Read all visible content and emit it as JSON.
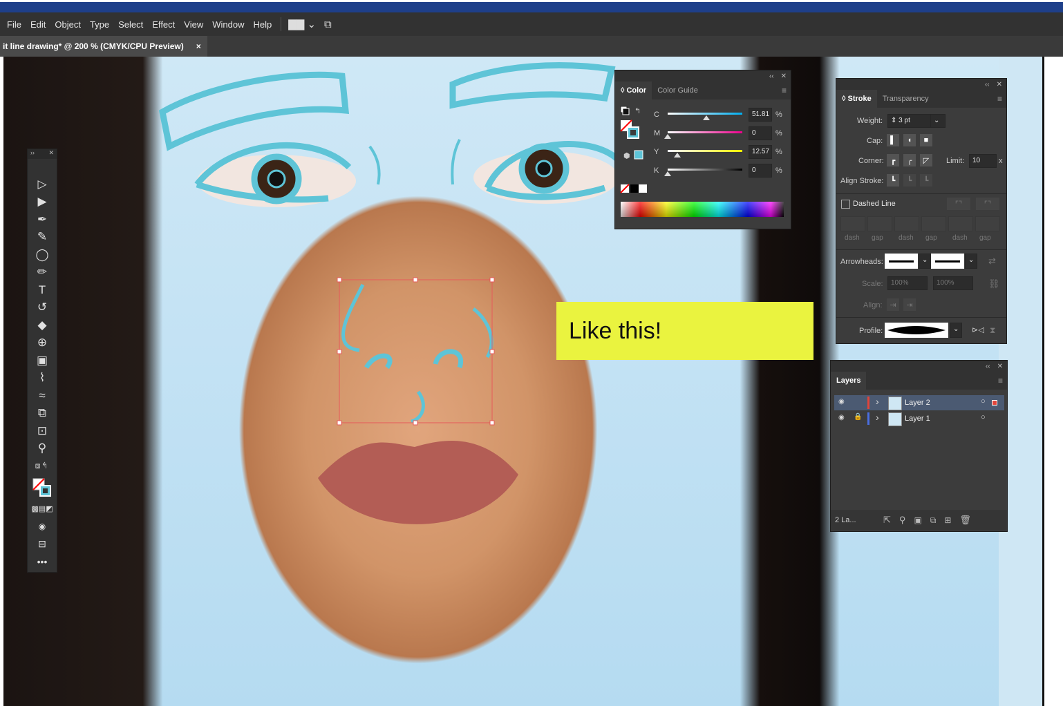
{
  "menu": {
    "items": [
      "File",
      "Edit",
      "Object",
      "Type",
      "Select",
      "Effect",
      "View",
      "Window",
      "Help"
    ],
    "workspace_icon": "workspace-switcher-icon",
    "arrange_icon": "arrange-documents-icon"
  },
  "doc_tab": {
    "title": "it line drawing* @ 200 % (CMYK/CPU Preview)",
    "close": "×"
  },
  "note": {
    "text": "Like this!"
  },
  "color_panel": {
    "tabs": [
      "◊ Color",
      "Color Guide"
    ],
    "channels": [
      {
        "label": "C",
        "value": "51.81",
        "pct": 51.81,
        "unit": "%"
      },
      {
        "label": "M",
        "value": "0",
        "pct": 0,
        "unit": "%"
      },
      {
        "label": "Y",
        "value": "12.57",
        "pct": 12.57,
        "unit": "%"
      },
      {
        "label": "K",
        "value": "0",
        "pct": 0,
        "unit": "%"
      }
    ],
    "stroke_color": "#5ec4d7"
  },
  "stroke_panel": {
    "tabs": [
      "◊ Stroke",
      "Transparency"
    ],
    "weight_label": "Weight:",
    "weight_value": "3 pt",
    "cap_label": "Cap:",
    "corner_label": "Corner:",
    "limit_label": "Limit:",
    "limit_value": "10",
    "limit_x": "x",
    "align_label": "Align Stroke:",
    "dashed_label": "Dashed Line",
    "dash_labels": [
      "dash",
      "gap",
      "dash",
      "gap",
      "dash",
      "gap"
    ],
    "arrowheads_label": "Arrowheads:",
    "scale_label": "Scale:",
    "scale_values": [
      "100%",
      "100%"
    ],
    "align_label2": "Align:",
    "profile_label": "Profile:"
  },
  "layers_panel": {
    "tab": "Layers",
    "layers": [
      {
        "name": "Layer 2",
        "color": "#e0443a",
        "locked": false,
        "selected": true
      },
      {
        "name": "Layer 1",
        "color": "#4a6ee0",
        "locked": true,
        "selected": false
      }
    ],
    "footer_count": "2 La..."
  },
  "colors": {
    "stroke_cyan": "#5ec4d7",
    "selection": "#e65a5a",
    "note_bg": "#eaf33f"
  }
}
